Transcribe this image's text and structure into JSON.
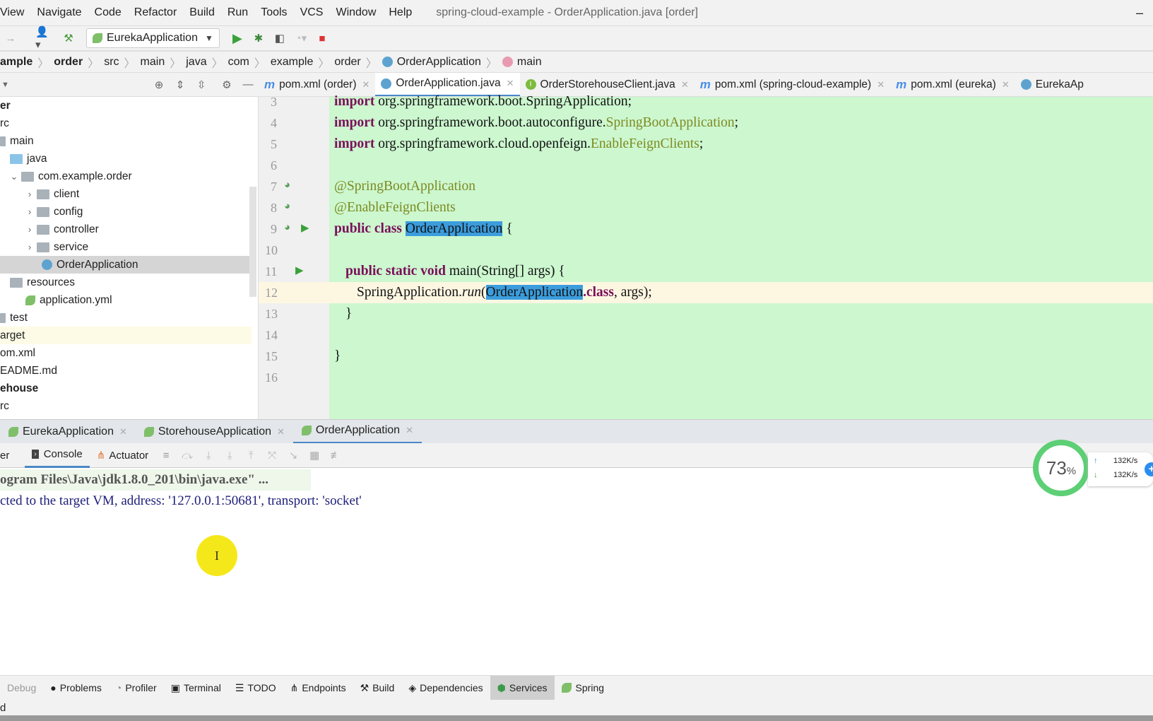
{
  "menu": {
    "items": [
      "View",
      "Navigate",
      "Code",
      "Refactor",
      "Build",
      "Run",
      "Tools",
      "VCS",
      "Window",
      "Help"
    ],
    "window_title": "spring-cloud-example - OrderApplication.java [order]",
    "minimize": "–"
  },
  "toolbar": {
    "run_config": "EurekaApplication"
  },
  "breadcrumb": [
    "ample",
    "order",
    "src",
    "main",
    "java",
    "com",
    "example",
    "order",
    "OrderApplication",
    "main"
  ],
  "project_tree": [
    {
      "label": "er",
      "bold": true
    },
    {
      "label": "rc"
    },
    {
      "label": "main"
    },
    {
      "label": "java"
    },
    {
      "label": "com.example.order"
    },
    {
      "label": "client"
    },
    {
      "label": "config"
    },
    {
      "label": "controller"
    },
    {
      "label": "service"
    },
    {
      "label": "OrderApplication",
      "selected": true
    },
    {
      "label": "resources"
    },
    {
      "label": "application.yml"
    },
    {
      "label": "test"
    },
    {
      "label": "arget"
    },
    {
      "label": "om.xml"
    },
    {
      "label": "EADME.md"
    },
    {
      "label": "ehouse",
      "bold": true
    },
    {
      "label": "rc"
    }
  ],
  "editor_tabs": [
    {
      "label": "pom.xml (order)",
      "icon": "m"
    },
    {
      "label": "OrderApplication.java",
      "icon": "c",
      "active": true
    },
    {
      "label": "OrderStorehouseClient.java",
      "icon": "i"
    },
    {
      "label": "pom.xml (spring-cloud-example)",
      "icon": "m"
    },
    {
      "label": "pom.xml (eureka)",
      "icon": "m"
    },
    {
      "label": "EurekaAp",
      "icon": "c"
    }
  ],
  "code": {
    "line_numbers": [
      "3",
      "4",
      "5",
      "6",
      "7",
      "8",
      "9",
      "10",
      "11",
      "12",
      "13",
      "14",
      "15",
      "16"
    ],
    "l3a": "import",
    "l3b": " org.springframework.boot.SpringApplication;",
    "l4a": "import",
    "l4b": " org.springframework.boot.autoconfigure.",
    "l4c": "SpringBootApplication",
    "l4d": ";",
    "l5a": "import",
    "l5b": " org.springframework.cloud.openfeign.",
    "l5c": "EnableFeignClients",
    "l5d": ";",
    "l7": "@SpringBootApplication",
    "l8": "@EnableFeignClients",
    "l9a": "public class ",
    "l9b": "OrderApplication",
    "l9c": " {",
    "l11a": "public static void ",
    "l11b": "main(String[] args) {",
    "l12a": "SpringApplication.",
    "l12b": "run",
    "l12c": "(",
    "l12d": "OrderApplication",
    "l12e": ".class",
    "l12f": ", args);",
    "l13": "}",
    "l15": "}"
  },
  "services_tabs": [
    {
      "label": "EurekaApplication"
    },
    {
      "label": "StorehouseApplication"
    },
    {
      "label": "OrderApplication",
      "active": true
    }
  ],
  "console_toolbar": {
    "left_cut": "er",
    "console": "Console",
    "actuator": "Actuator"
  },
  "console": {
    "line1": "ogram Files\\Java\\jdk1.8.0_201\\bin\\java.exe\" ...",
    "line2": "cted to the target VM, address: '127.0.0.1:50681', transport: 'socket'"
  },
  "tool_windows": [
    "Debug",
    "Problems",
    "Profiler",
    "Terminal",
    "TODO",
    "Endpoints",
    "Build",
    "Dependencies",
    "Services",
    "Spring"
  ],
  "active_tool_window": "Services",
  "status": "d",
  "net_widget": {
    "percent": "73",
    "unit": "%",
    "up": "132K/s",
    "down": "132K/s"
  },
  "colors": {
    "editor_bg": "#ccf7cf",
    "selection": "#3b9ddd",
    "keyword": "#7a0f5a",
    "annotation": "#7d8a1f",
    "accent": "#4a88c7"
  }
}
